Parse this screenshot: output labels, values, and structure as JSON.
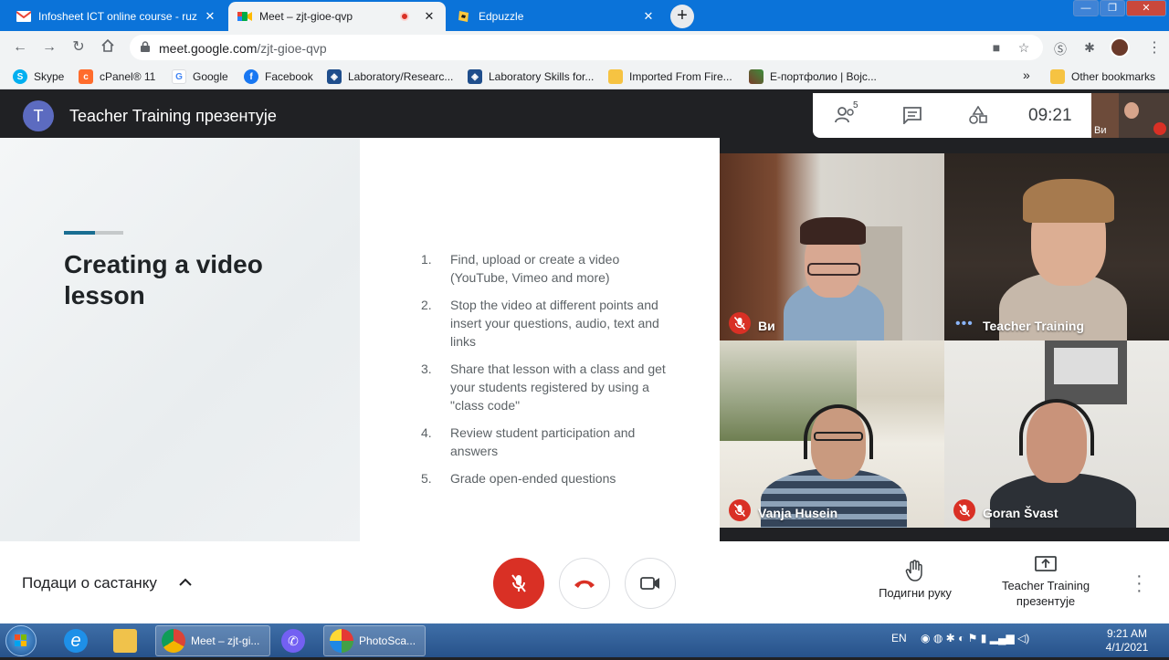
{
  "browser": {
    "tabs": [
      {
        "title": "Infosheet ICT online course - ruzi",
        "favicon": "gmail-icon"
      },
      {
        "title": "Meet – zjt-gioe-qvp",
        "favicon": "meet-icon",
        "active": true
      },
      {
        "title": "Edpuzzle",
        "favicon": "edpuzzle-icon"
      }
    ],
    "new_tab": "+",
    "address": {
      "host": "meet.google.com",
      "path": "/zjt-gioe-qvp"
    },
    "bookmarks": [
      {
        "label": "Skype",
        "icon": "skype-icon",
        "color": "#00aff0"
      },
      {
        "label": "cPanel® 11",
        "icon": "cpanel-icon",
        "color": "#ff6c2c"
      },
      {
        "label": "Google",
        "icon": "google-icon",
        "color": "#4285f4"
      },
      {
        "label": "Facebook",
        "icon": "facebook-icon",
        "color": "#1877f2"
      },
      {
        "label": "Laboratory/Researc...",
        "icon": "shield-icon",
        "color": "#1f4e8c"
      },
      {
        "label": "Laboratory Skills for...",
        "icon": "shield-icon",
        "color": "#1f4e8c"
      },
      {
        "label": "Imported From Fire...",
        "icon": "folder-icon",
        "color": "#f6c342"
      },
      {
        "label": "Е-портфолио | Bojc...",
        "icon": "portfolio-icon",
        "color": "#7a3d2a"
      }
    ],
    "bookmarks_overflow": "»",
    "other_bookmarks": "Other bookmarks"
  },
  "meet": {
    "presenter_initial": "T",
    "presenter_title": "Teacher Training презентује",
    "participant_count": "5",
    "time": "09:21",
    "self_label": "Ви",
    "slide": {
      "heading": "Creating a video lesson",
      "steps": [
        {
          "num": "1.",
          "text": "Find, upload or create a video (YouTube, Vimeo and more)"
        },
        {
          "num": "2.",
          "text": "Stop the video at different points and insert your questions, audio, text and links"
        },
        {
          "num": "3.",
          "text": "Share that lesson with a class and get your students registered by using a \"class code\""
        },
        {
          "num": "4.",
          "text": "Review student participation and answers"
        },
        {
          "num": "5.",
          "text": "Grade open-ended questions"
        }
      ]
    },
    "participants": [
      {
        "name": "Ви",
        "muted": true
      },
      {
        "name": "Teacher Training",
        "muted": false,
        "speaking": true
      },
      {
        "name": "Vanja Husein",
        "muted": true
      },
      {
        "name": "Goran Švast",
        "muted": true
      }
    ],
    "controls": {
      "meeting_details": "Подаци о састанку",
      "raise_hand": "Подигни руку",
      "presenting_line1": "Teacher Training",
      "presenting_line2": "презентује"
    },
    "accent_red": "#d93025"
  },
  "taskbar": {
    "items": [
      {
        "label": "Meet – zjt-gi...",
        "icon": "chrome-icon"
      },
      {
        "label": "PhotoSca...",
        "icon": "photoscape-icon"
      }
    ],
    "lang": "EN",
    "time": "9:21 AM",
    "date": "4/1/2021"
  }
}
